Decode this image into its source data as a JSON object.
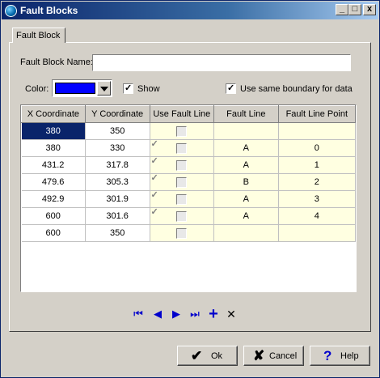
{
  "window": {
    "title": "Fault Blocks",
    "minimize": "_",
    "maximize": "□",
    "close": "x"
  },
  "tab": {
    "label": "Fault Block"
  },
  "form": {
    "name_label": "Fault Block Name:",
    "name_value": "",
    "color_label": "Color:",
    "color_value": "#0000ff",
    "show_label": "Show",
    "show_checked": true,
    "same_boundary_label": "Use same boundary for data",
    "same_boundary_checked": true
  },
  "grid": {
    "columns": [
      "X Coordinate",
      "Y Coordinate",
      "Use Fault Line",
      "Fault Line",
      "Fault Line Point"
    ],
    "rows": [
      {
        "x": "380",
        "y": "350",
        "use": false,
        "line": "",
        "point": ""
      },
      {
        "x": "380",
        "y": "330",
        "use": true,
        "line": "A",
        "point": "0"
      },
      {
        "x": "431.2",
        "y": "317.8",
        "use": true,
        "line": "A",
        "point": "1"
      },
      {
        "x": "479.6",
        "y": "305.3",
        "use": true,
        "line": "B",
        "point": "2"
      },
      {
        "x": "492.9",
        "y": "301.9",
        "use": true,
        "line": "A",
        "point": "3"
      },
      {
        "x": "600",
        "y": "301.6",
        "use": true,
        "line": "A",
        "point": "4"
      },
      {
        "x": "600",
        "y": "350",
        "use": false,
        "line": "",
        "point": ""
      }
    ]
  },
  "nav": {
    "first": "⏮",
    "prev": "◀",
    "next": "▶",
    "last": "⏭",
    "add": "+",
    "delete": "✕"
  },
  "buttons": {
    "ok": "Ok",
    "cancel": "Cancel",
    "help": "Help"
  }
}
